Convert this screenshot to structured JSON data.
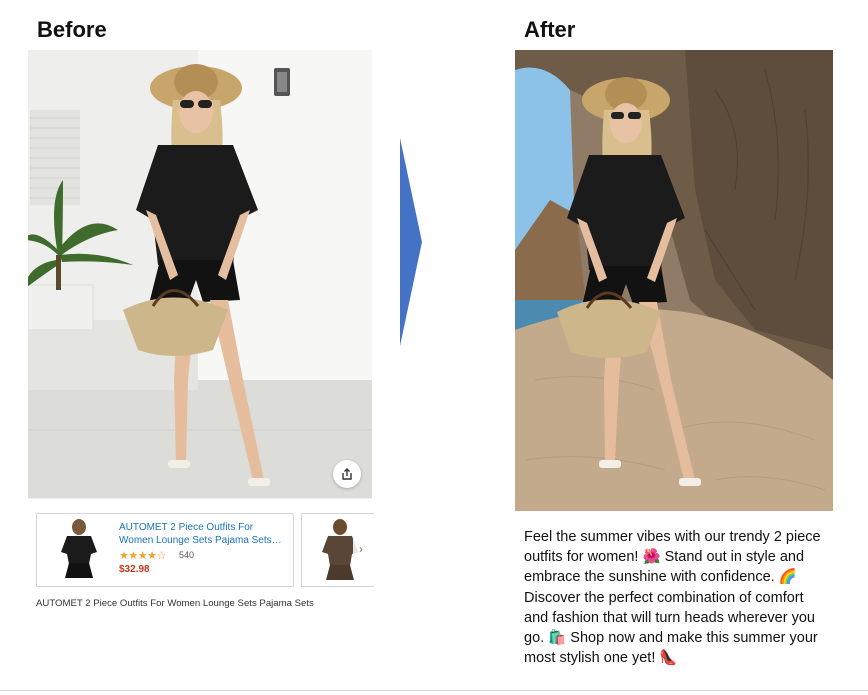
{
  "headings": {
    "before": "Before",
    "after": "After"
  },
  "product": {
    "title": "AUTOMET 2 Piece Outfits For Women Lounge Sets Pajama Sets…",
    "stars": "★★★★☆",
    "rating_count": "540",
    "price": "$32.98",
    "caption": "AUTOMET 2 Piece Outfits For Women Lounge Sets Pajama Sets"
  },
  "after_text": {
    "part1": "Feel the summer vibes with our trendy 2 piece outfits for women!",
    "emoji1": "🌺",
    "part2": "Stand out in style and embrace the sunshine with confidence.",
    "emoji2": "🌈",
    "part3": "Discover the perfect combination of comfort and fashion that will turn heads wherever you go.",
    "emoji3": "🛍️",
    "part4": "Shop now and make this summer your most stylish one yet!",
    "emoji4": "👠"
  },
  "icons": {
    "share": "share-icon",
    "next": "chevron-right-icon",
    "arrow": "arrow-right-icon"
  },
  "colors": {
    "arrow": "#4472c4",
    "price": "#c7361e",
    "link": "#1a73b8",
    "stars": "#f0a22d"
  }
}
